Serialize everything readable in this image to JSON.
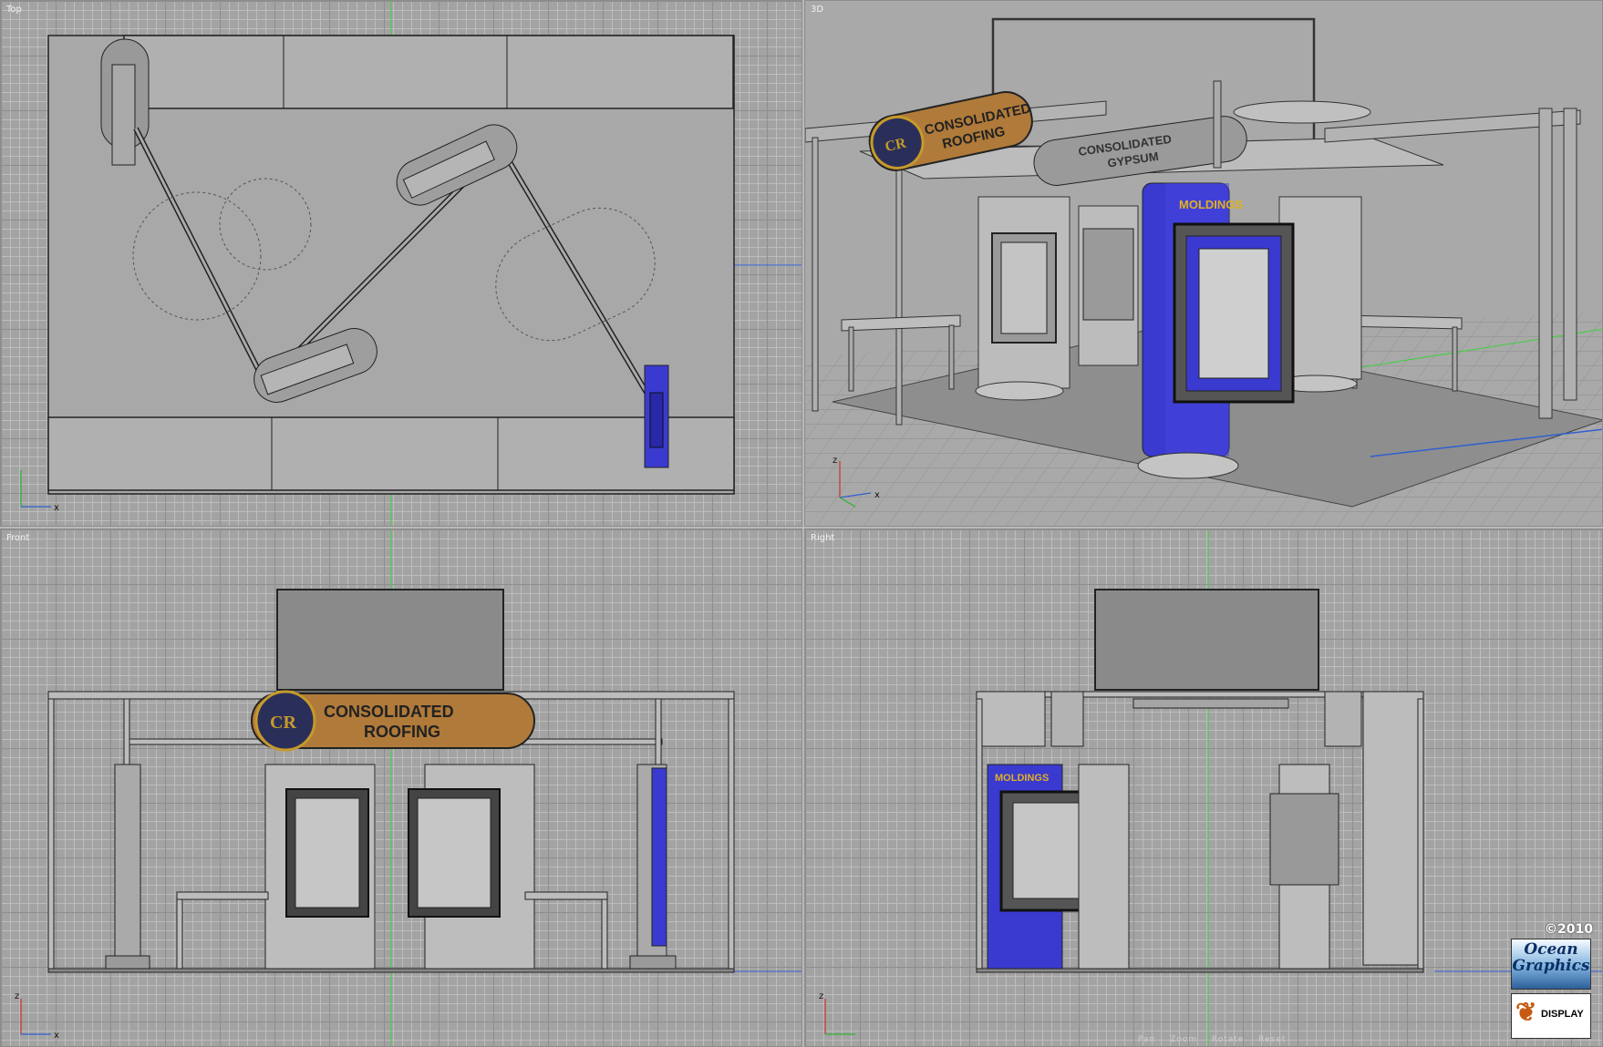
{
  "viewports": {
    "top": {
      "label": "Top"
    },
    "persp": {
      "label": "3D"
    },
    "front": {
      "label": "Front"
    },
    "right": {
      "label": "Right"
    }
  },
  "axes": {
    "x": "x",
    "z": "z"
  },
  "signs": {
    "brand_line1": "CONSOLIDATED",
    "brand_line2": "ROOFING",
    "brand2_line1": "CONSOLIDATED",
    "brand2_line2": "GYPSUM",
    "monogram": "CR",
    "moldings": "MOLDINGS"
  },
  "branding": {
    "copyright": "©2010",
    "logo1_line1": "Ocean",
    "logo1_line2": "Graphics",
    "logo2_text": "DISPLAY",
    "logo2_icon": "maple-leaf-icon"
  },
  "view_nav": {
    "items": [
      "Pan",
      "Zoom",
      "Rotate",
      "Reset"
    ]
  },
  "colors": {
    "accent_blue": "#3a3ad0",
    "sign_orange": "#b07a3a",
    "axis_green": "#3fd03f",
    "axis_blue": "#2f5fd0",
    "axis_red": "#d02f2f"
  }
}
